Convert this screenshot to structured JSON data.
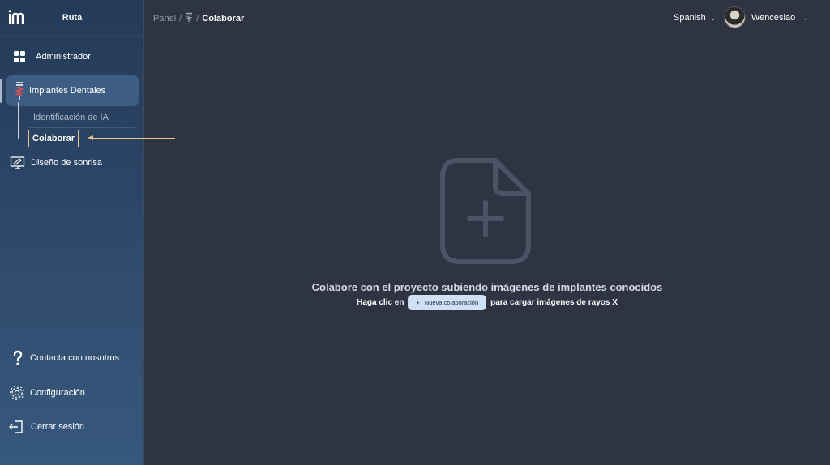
{
  "brand": {
    "name": "Ruta"
  },
  "sidebar": {
    "items": [
      {
        "label": "Administrador",
        "icon": "grid-icon"
      },
      {
        "label": "Implantes Dentales",
        "icon": "dental-implant-icon"
      },
      {
        "label": "Diseño de sonrisa",
        "icon": "monitor-pen-icon"
      }
    ],
    "subitems": [
      {
        "label": "Identificación de IA"
      },
      {
        "label": "Colaborar"
      }
    ],
    "bottom": [
      {
        "label": "Contacta con nosotros",
        "icon": "question-icon"
      },
      {
        "label": "Configuración",
        "icon": "gear-icon"
      },
      {
        "label": "Cerrar sesión",
        "icon": "logout-icon"
      }
    ]
  },
  "header": {
    "breadcrumb": {
      "root": "Panel",
      "sep": "/",
      "current": "Colaborar"
    },
    "language": "Spanish",
    "user": "Wenceslao"
  },
  "main": {
    "title": "Colabore con el proyecto subiendo imágenes de implantes conocidos",
    "sub_prefix": "Haga clic en",
    "button_label": "Nueva colaboración",
    "button_plus": "+",
    "sub_suffix": "para cargar imágenes de rayos X"
  },
  "colors": {
    "accent": "#e8c58a",
    "background": "#2f3443",
    "button": "#cfe0f7"
  }
}
